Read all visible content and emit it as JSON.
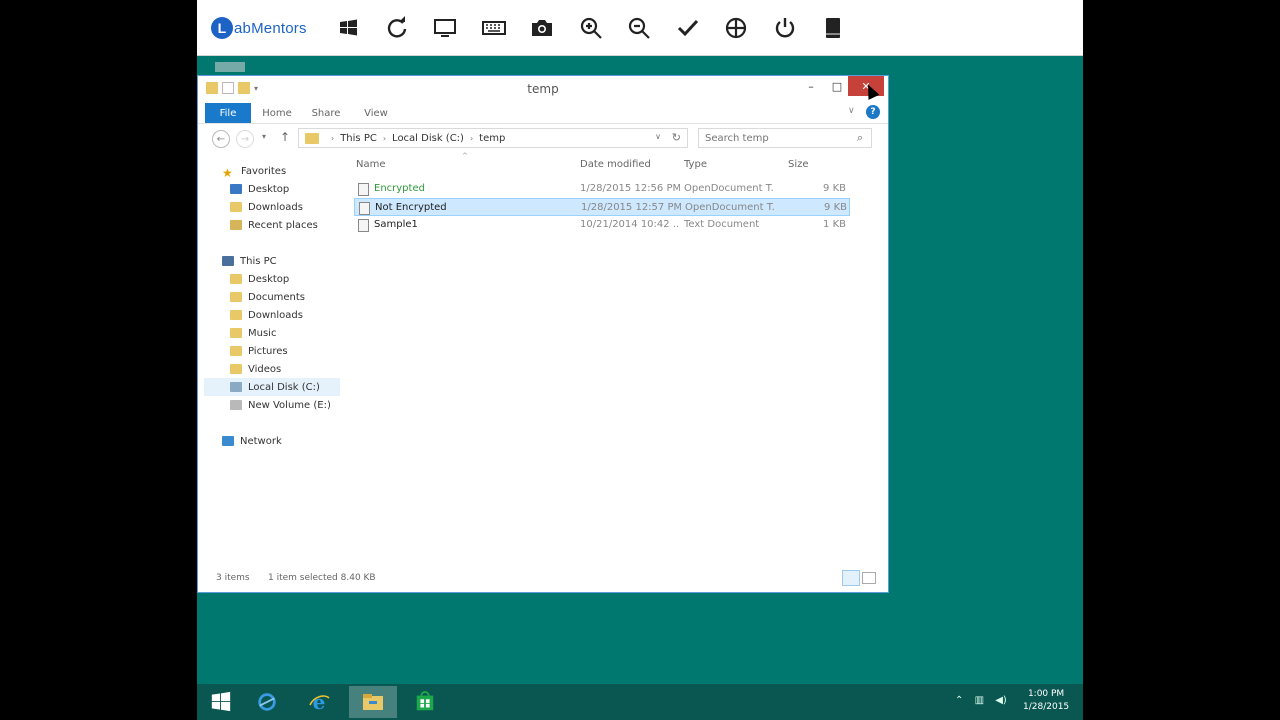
{
  "brand": {
    "logo_letter": "L",
    "logo_text": "abMentors"
  },
  "toolbar_icons": [
    "windows-key-icon",
    "refresh-icon",
    "monitor-icon",
    "keyboard-icon",
    "camera-icon",
    "zoom-in-icon",
    "zoom-out-icon",
    "checkmark-icon",
    "move-icon",
    "power-icon",
    "manual-icon"
  ],
  "window": {
    "title": "temp",
    "minimize": "–",
    "maximize": "□",
    "close": "✕"
  },
  "ribbon": {
    "tabs": [
      "File",
      "Home",
      "Share",
      "View"
    ],
    "help": "?"
  },
  "address": {
    "crumbs": [
      "This PC",
      "Local Disk (C:)",
      "temp"
    ],
    "search_placeholder": "Search temp"
  },
  "navpane": {
    "favorites": "Favorites",
    "favorites_items": [
      "Desktop",
      "Downloads",
      "Recent places"
    ],
    "this_pc": "This PC",
    "pc_items": [
      "Desktop",
      "Documents",
      "Downloads",
      "Music",
      "Pictures",
      "Videos",
      "Local Disk (C:)",
      "New Volume (E:)"
    ],
    "network": "Network"
  },
  "columns": {
    "name": "Name",
    "date": "Date modified",
    "type": "Type",
    "size": "Size"
  },
  "files": [
    {
      "name": "Encrypted",
      "date": "1/28/2015 12:56 PM",
      "type": "OpenDocument T...",
      "size": "9 KB"
    },
    {
      "name": "Not Encrypted",
      "date": "1/28/2015 12:57 PM",
      "type": "OpenDocument T...",
      "size": "9 KB"
    },
    {
      "name": "Sample1",
      "date": "10/21/2014 10:42 ...",
      "type": "Text Document",
      "size": "1 KB"
    }
  ],
  "status": {
    "items": "3 items",
    "selected": "1 item selected  8.40 KB"
  },
  "taskbar": {
    "time": "1:00 PM",
    "date": "1/28/2015"
  },
  "colors": {
    "desktop": "#00786f",
    "accent": "#1979ca",
    "close": "#c5413a",
    "taskbar": "#0a5752"
  }
}
